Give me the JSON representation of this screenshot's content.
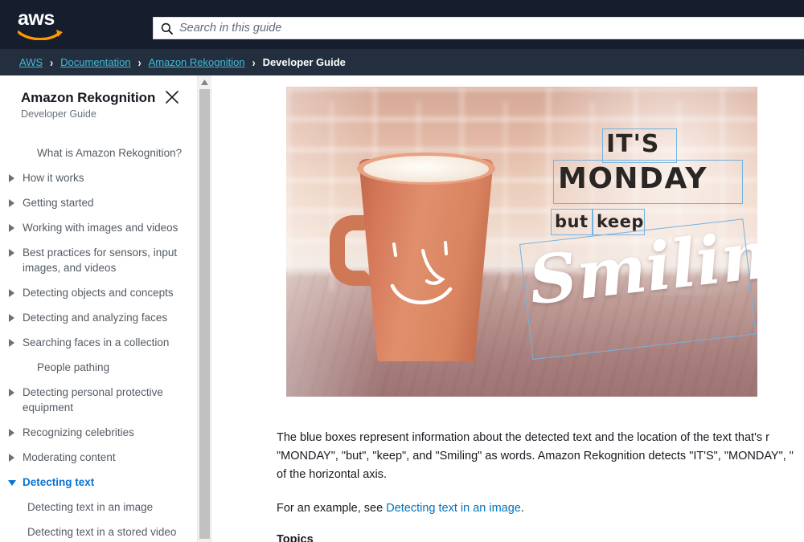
{
  "header": {
    "logo_alt": "aws",
    "search": {
      "placeholder": "Search in this guide",
      "value": ""
    }
  },
  "breadcrumb": {
    "items": [
      {
        "label": "AWS",
        "current": false
      },
      {
        "label": "Documentation",
        "current": false
      },
      {
        "label": "Amazon Rekognition",
        "current": false
      },
      {
        "label": "Developer Guide",
        "current": true
      }
    ],
    "separator": "›"
  },
  "sidebar": {
    "title": "Amazon Rekognition",
    "subtitle": "Developer Guide",
    "close_label": "×",
    "items": [
      {
        "label": "What is Amazon Rekognition?",
        "caret": "none",
        "active": false,
        "child": false
      },
      {
        "label": "How it works",
        "caret": "collapsed",
        "active": false,
        "child": false
      },
      {
        "label": "Getting started",
        "caret": "collapsed",
        "active": false,
        "child": false
      },
      {
        "label": "Working with images and videos",
        "caret": "collapsed",
        "active": false,
        "child": false
      },
      {
        "label": "Best practices for sensors, input images, and videos",
        "caret": "collapsed",
        "active": false,
        "child": false
      },
      {
        "label": "Detecting objects and concepts",
        "caret": "collapsed",
        "active": false,
        "child": false
      },
      {
        "label": "Detecting and analyzing faces",
        "caret": "collapsed",
        "active": false,
        "child": false
      },
      {
        "label": "Searching faces in a collection",
        "caret": "collapsed",
        "active": false,
        "child": false
      },
      {
        "label": "People pathing",
        "caret": "none",
        "active": false,
        "child": false
      },
      {
        "label": "Detecting personal protective equipment",
        "caret": "collapsed",
        "active": false,
        "child": false
      },
      {
        "label": "Recognizing celebrities",
        "caret": "collapsed",
        "active": false,
        "child": false
      },
      {
        "label": "Moderating content",
        "caret": "collapsed",
        "active": false,
        "child": false
      },
      {
        "label": "Detecting text",
        "caret": "expanded",
        "active": true,
        "child": false
      },
      {
        "label": "Detecting text in an image",
        "caret": "none",
        "active": false,
        "child": true
      },
      {
        "label": "Detecting text in a stored video",
        "caret": "none",
        "active": false,
        "child": true
      }
    ]
  },
  "figure": {
    "alt": "Coffee mug with a smiley face next to handwritten text reading IT'S MONDAY but keep Smiling, each word outlined by a blue detection box",
    "detected_words": [
      "IT'S",
      "MONDAY",
      "but",
      "keep",
      "Smiling"
    ],
    "box_color": "#74b3e0"
  },
  "content": {
    "paragraph_1_line_1": "The blue boxes represent information about the detected text and the location of the text that's r",
    "paragraph_1_line_2": "\"MONDAY\", \"but\", \"keep\", and \"Smiling\" as words. Amazon Rekognition detects \"IT'S\", \"MONDAY\", \"",
    "paragraph_1_line_3": "of the horizontal axis.",
    "paragraph_2_prefix": "For an example, see ",
    "paragraph_2_link": "Detecting text in an image",
    "paragraph_2_suffix": ".",
    "topics_heading": "Topics"
  },
  "colors": {
    "header_bg": "#161e2d",
    "breadcrumb_bg": "#232f3e",
    "breadcrumb_link": "#44b9d6",
    "accent_orange": "#ff9900",
    "active_nav": "#0972d3",
    "body_link": "#0073bb",
    "nav_text": "#545b64"
  }
}
